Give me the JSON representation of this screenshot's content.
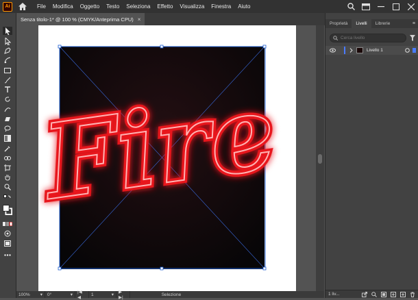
{
  "app": {
    "logo": "Ai"
  },
  "menu": [
    "File",
    "Modifica",
    "Oggetto",
    "Testo",
    "Seleziona",
    "Effetto",
    "Visualizza",
    "Finestra",
    "Aiuto"
  ],
  "document_tab": {
    "title": "Senza titolo-1* @ 100 % (CMYK/Anteprima CPU)",
    "close": "×"
  },
  "artwork": {
    "text": "Fire",
    "neon_color": "#e8141e",
    "background": "#0c0a0c"
  },
  "status": {
    "zoom": "100%",
    "rotation": "0°",
    "artboard": "1",
    "tool": "Selezione"
  },
  "panel": {
    "tabs": [
      "Proprietà",
      "Livelli",
      "Librerie"
    ],
    "active_tab": "Livelli",
    "search_placeholder": "Cerca livello",
    "layer_name": "Livello 1",
    "footer_count": "1 liv..."
  }
}
